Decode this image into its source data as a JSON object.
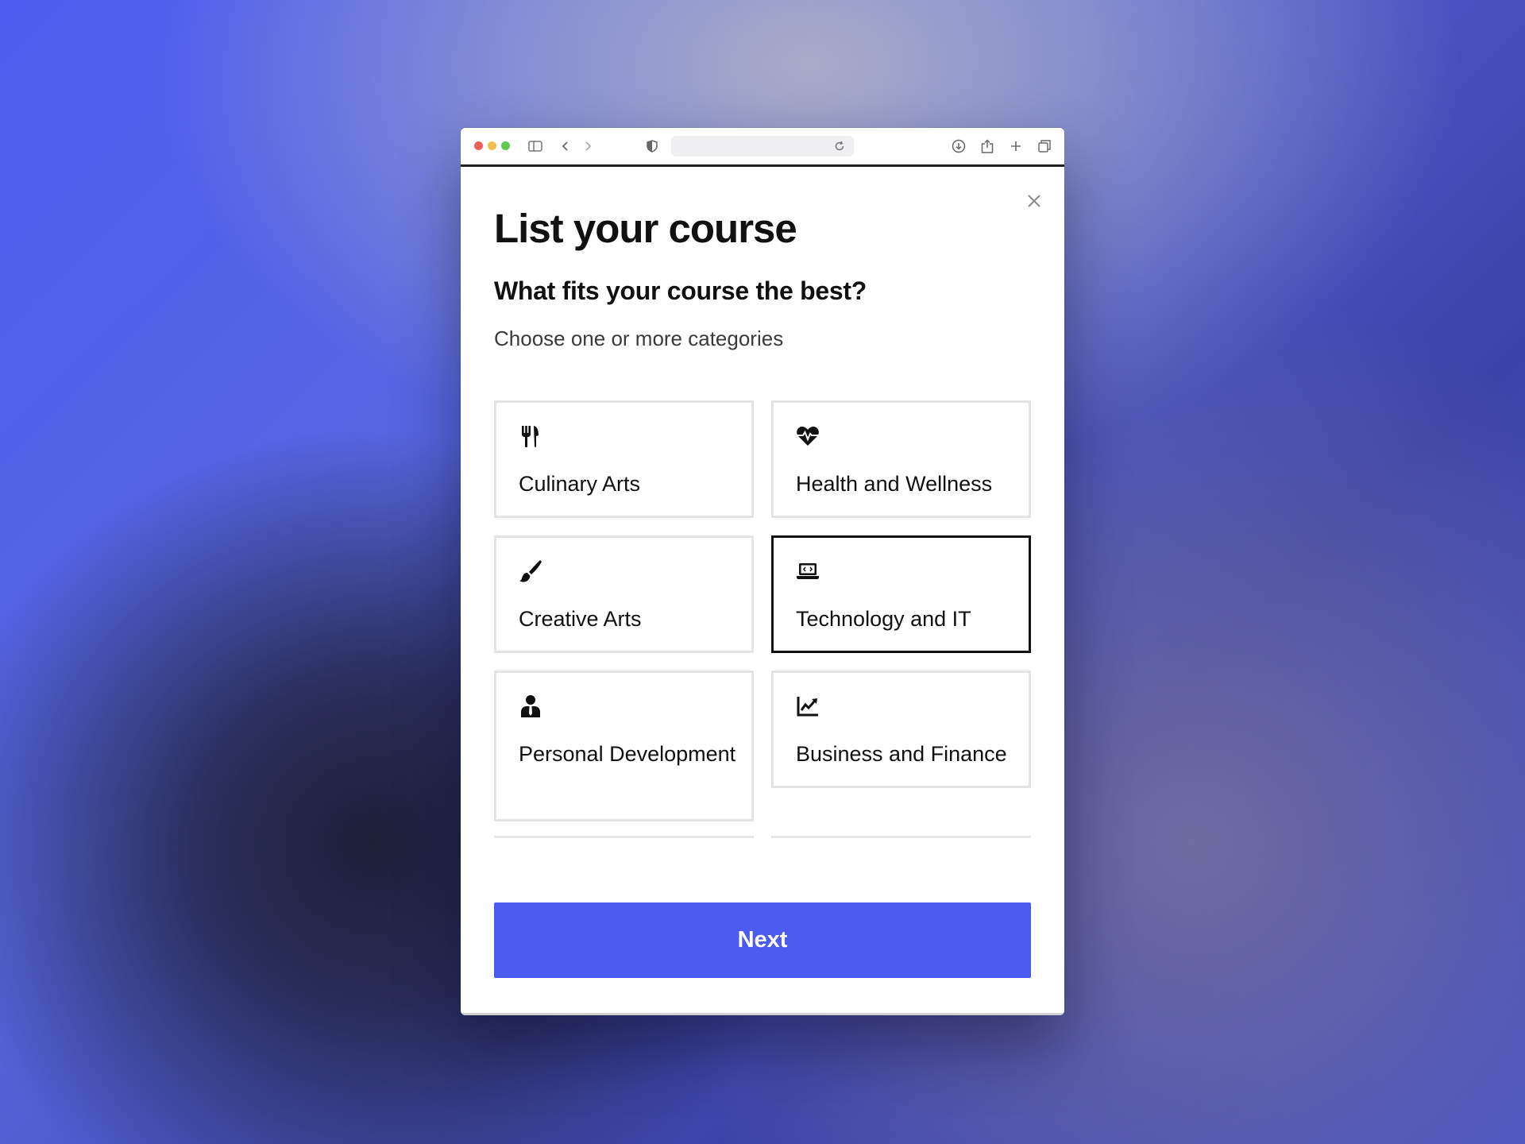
{
  "browser": {
    "icons": [
      "sidebar-icon",
      "back-icon",
      "forward-icon",
      "shield-icon",
      "reload-icon",
      "download-icon",
      "share-icon",
      "new-tab-icon",
      "tabs-overview-icon"
    ],
    "url": ""
  },
  "modal": {
    "title": "List your course",
    "question": "What fits your course the best?",
    "helper": "Choose one or more categories",
    "categories": [
      {
        "label": "Culinary Arts",
        "icon": "utensils-icon",
        "selected": false
      },
      {
        "label": "Health and Wellness",
        "icon": "heart-pulse-icon",
        "selected": false
      },
      {
        "label": "Creative Arts",
        "icon": "paintbrush-icon",
        "selected": false
      },
      {
        "label": "Technology and IT",
        "icon": "laptop-code-icon",
        "selected": true
      },
      {
        "label": "Personal Development",
        "icon": "user-tie-icon",
        "selected": false
      },
      {
        "label": "Business and Finance",
        "icon": "chart-line-icon",
        "selected": false
      }
    ],
    "next_label": "Next"
  },
  "colors": {
    "accent": "#4b5aef",
    "selected_border": "#111111",
    "card_border": "#e4e4e4"
  }
}
